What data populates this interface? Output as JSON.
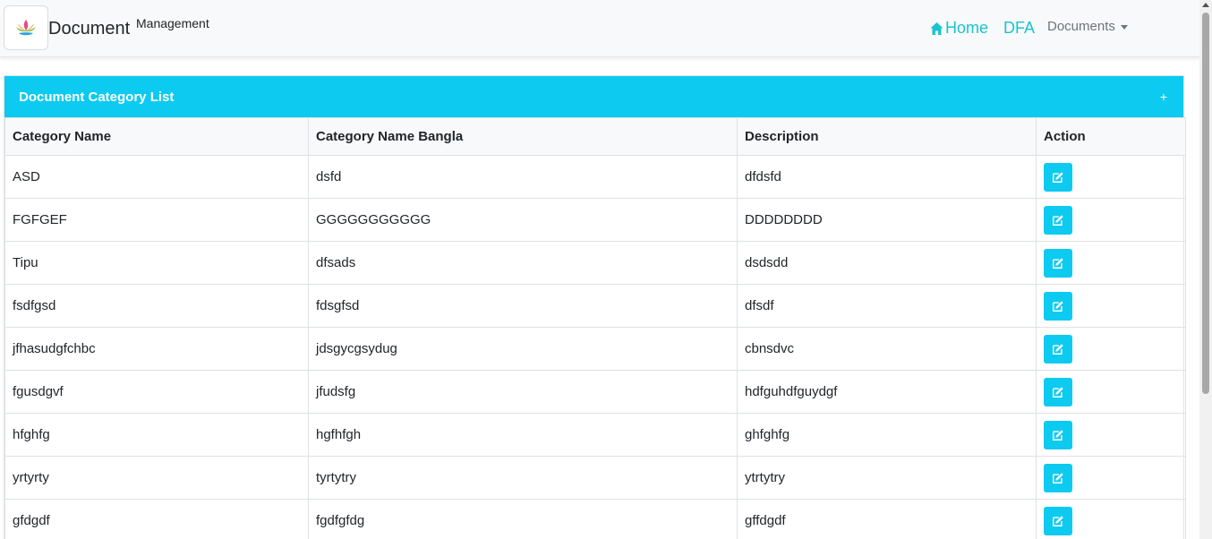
{
  "navbar": {
    "brand": "Document",
    "brand_sup": "Management",
    "links": {
      "home": "Home",
      "dfa": "DFA",
      "documents": "Documents"
    }
  },
  "card": {
    "title": "Document Category List",
    "add_label": "+"
  },
  "table": {
    "headers": [
      "Category Name",
      "Category Name Bangla",
      "Description",
      "Action"
    ],
    "rows": [
      [
        "ASD",
        "dsfd",
        "dfdsfd"
      ],
      [
        "FGFGEF",
        "GGGGGGGGGGG",
        "DDDDDDDD"
      ],
      [
        "Tipu",
        "dfsads",
        "dsdsdd"
      ],
      [
        "fsdfgsd",
        "fdsgfsd",
        "dfsdf"
      ],
      [
        "jfhasudgfchbc",
        "jdsgycgsydug",
        "cbnsdvc"
      ],
      [
        "fgusdgvf",
        "jfudsfg",
        "hdfguhdfguydgf"
      ],
      [
        "hfghfg",
        "hgfhfgh",
        "ghfghfg"
      ],
      [
        "yrtyrty",
        "tyrtytry",
        "ytrtytry"
      ],
      [
        "gfdgdf",
        "fgdfgfdg",
        "gffdgdf"
      ]
    ]
  },
  "colors": {
    "accent": "#0dcaf0",
    "nav_link": "#1bc3d1"
  },
  "icons": {
    "home": "home-icon",
    "edit": "edit-icon",
    "logo": "lotus-logo-icon"
  }
}
